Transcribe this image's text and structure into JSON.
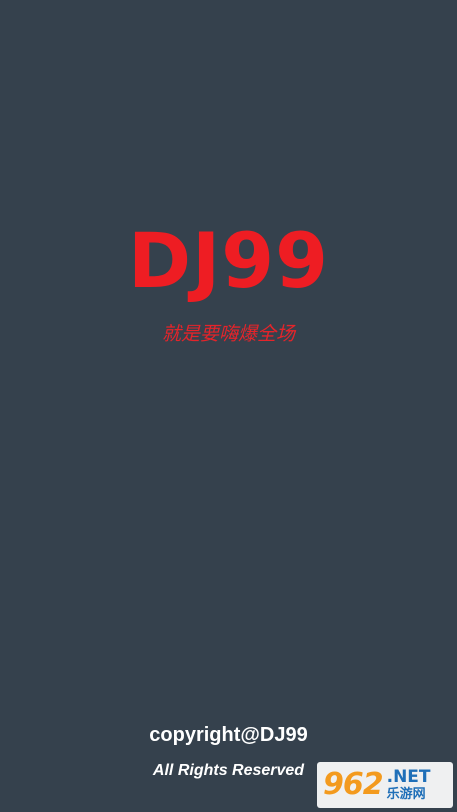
{
  "colors": {
    "background": "#35414d",
    "brand": "#ee1d23",
    "footer_text": "#ffffff"
  },
  "splash": {
    "app_title": "DJ99",
    "slogan": "就是要嗨爆全场"
  },
  "footer": {
    "copyright": "copyright@DJ99",
    "rights": "All Rights Reserved"
  },
  "watermark": {
    "number": "962",
    "suffix": ".NET",
    "site_name": "乐游网"
  }
}
